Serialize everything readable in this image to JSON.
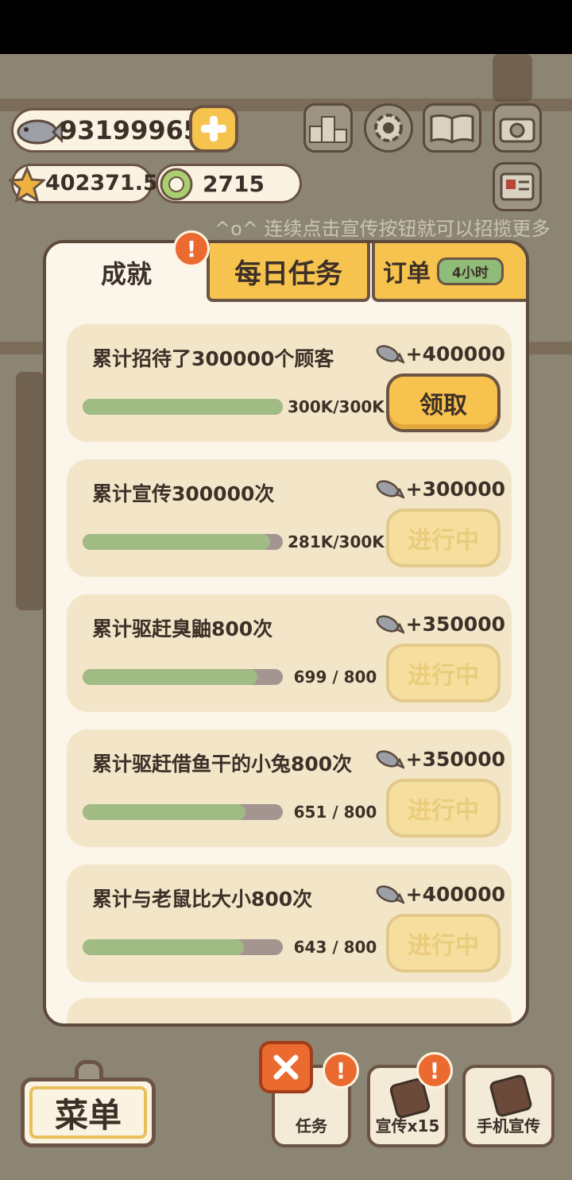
{
  "currency": {
    "fish": "93199965",
    "stars": "402371.5",
    "tokens": "2715"
  },
  "hint_text": "^o^ 连续点击宣传按钮就可以招揽更多",
  "tabs": {
    "achievements": "成就",
    "daily": "每日任务",
    "orders": "订单",
    "orders_timer": "4小时"
  },
  "alert_mark": "!",
  "achievements": [
    {
      "title": "累计招待了300000个顾客",
      "reward": "+400000",
      "count": "300K/300K",
      "progress": 1.0,
      "button": "领取",
      "state": "claim"
    },
    {
      "title": "累计宣传300000次",
      "reward": "+300000",
      "count": "281K/300K",
      "progress": 0.937,
      "button": "进行中",
      "state": "progress"
    },
    {
      "title": "累计驱赶臭鼬800次",
      "reward": "+350000",
      "count": "699 / 800",
      "progress": 0.874,
      "button": "进行中",
      "state": "progress"
    },
    {
      "title": "累计驱赶借鱼干的小兔800次",
      "reward": "+350000",
      "count": "651 / 800",
      "progress": 0.814,
      "button": "进行中",
      "state": "progress"
    },
    {
      "title": "累计与老鼠比大小800次",
      "reward": "+400000",
      "count": "643 / 800",
      "progress": 0.804,
      "button": "进行中",
      "state": "progress"
    }
  ],
  "bottom": {
    "menu": "菜单",
    "tasks": "任务",
    "promote": "宣传x15",
    "phone_promote": "手机宣传"
  },
  "colors": {
    "accent_yellow": "#f6c34e",
    "progress_green": "#a0bb84",
    "alert_orange": "#ea6a2f"
  }
}
